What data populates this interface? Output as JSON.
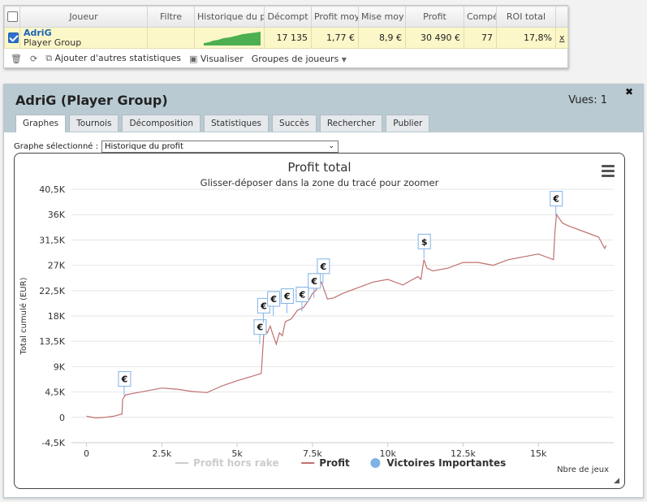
{
  "table": {
    "headers": [
      "Joueur",
      "Filtre",
      "Historique du p",
      "Décompt",
      "Profit moy",
      "Mise moy",
      "Profit",
      "Compé",
      "ROI total"
    ],
    "player_name": "AdriG",
    "player_group": "Player Group",
    "decompte": "17 135",
    "profit_moy": "1,77 €",
    "mise_moy": "8,9 €",
    "profit": "30 490 €",
    "compe": "77",
    "roi": "17,8%",
    "remove": "x"
  },
  "toolbar": {
    "add_stats": "Ajouter d'autres statistiques",
    "visualize": "Visualiser",
    "groups": "Groupes de joueurs"
  },
  "panel": {
    "title": "AdriG (Player Group)",
    "views": "Vues: 1",
    "close": "✖",
    "tabs": [
      "Graphes",
      "Tournois",
      "Décomposition",
      "Statistiques",
      "Succès",
      "Rechercher",
      "Publier"
    ],
    "select_label": "Graphe sélectionné :",
    "select_value": "Historique du profit"
  },
  "chart_data": {
    "type": "line",
    "title": "Profit total",
    "subtitle": "Glisser-déposer dans la zone du tracé pour zoomer",
    "ylabel": "Total cumulé (EUR)",
    "xlabel": "Nbre de jeux",
    "xlim": [
      -500,
      17500
    ],
    "ylim": [
      -4500,
      40500
    ],
    "xticks": [
      0,
      2500,
      5000,
      7500,
      10000,
      12500,
      15000
    ],
    "xtick_labels": [
      "0",
      "2.5k",
      "5k",
      "7.5k",
      "10k",
      "12.5k",
      "15k"
    ],
    "yticks": [
      -4500,
      0,
      4500,
      9000,
      13500,
      18000,
      22500,
      27000,
      31500,
      36000,
      40500
    ],
    "ytick_labels": [
      "-4,5K",
      "0",
      "4,5K",
      "9K",
      "13,5K",
      "18K",
      "22,5K",
      "27K",
      "31,5K",
      "36K",
      "40,5K"
    ],
    "legend": [
      {
        "name": "Profit hors rake",
        "color": "#cccccc",
        "marker": "line"
      },
      {
        "name": "Profit",
        "color": "#c07070",
        "marker": "line"
      },
      {
        "name": "Victoires Importantes",
        "color": "#7fb2e5",
        "marker": "circle"
      }
    ],
    "series": [
      {
        "name": "Profit",
        "color": "#c07070",
        "x": [
          0,
          300,
          600,
          900,
          1180,
          1200,
          1300,
          1500,
          2000,
          2500,
          3000,
          3500,
          4000,
          4500,
          5000,
          5500,
          5800,
          5850,
          5900,
          6000,
          6100,
          6200,
          6300,
          6400,
          6500,
          6600,
          6800,
          7000,
          7200,
          7400,
          7500,
          7600,
          7800,
          8000,
          8200,
          8500,
          9000,
          9500,
          10000,
          10500,
          11000,
          11100,
          11200,
          11300,
          11500,
          12000,
          12500,
          13000,
          13500,
          14000,
          14500,
          15000,
          15500,
          15550,
          15600,
          15800,
          16000,
          16500,
          17000,
          17200,
          17250
        ],
        "y": [
          200,
          -100,
          0,
          200,
          600,
          3200,
          4000,
          4200,
          4700,
          5200,
          5000,
          4600,
          4400,
          5600,
          6500,
          7300,
          7800,
          12000,
          16000,
          15000,
          16200,
          14500,
          13000,
          15000,
          14500,
          17000,
          17500,
          19000,
          19500,
          21000,
          22000,
          22500,
          24000,
          21000,
          21200,
          22000,
          23000,
          24000,
          24500,
          23500,
          25000,
          24500,
          28000,
          26500,
          26000,
          26500,
          27500,
          27500,
          27000,
          28000,
          28500,
          29000,
          28000,
          33000,
          36000,
          34500,
          34000,
          33000,
          32000,
          30000,
          30500
        ]
      }
    ],
    "victories": [
      {
        "x": 1250,
        "y": 3800,
        "label": "€"
      },
      {
        "x": 5750,
        "y": 13000,
        "label": "€"
      },
      {
        "x": 5870,
        "y": 16800,
        "label": "€"
      },
      {
        "x": 6200,
        "y": 18000,
        "label": "€"
      },
      {
        "x": 6650,
        "y": 18500,
        "label": "€"
      },
      {
        "x": 7150,
        "y": 18800,
        "label": "€"
      },
      {
        "x": 7550,
        "y": 21200,
        "label": "€"
      },
      {
        "x": 7850,
        "y": 23800,
        "label": "€"
      },
      {
        "x": 11200,
        "y": 28200,
        "label": "$"
      },
      {
        "x": 15580,
        "y": 35800,
        "label": "€"
      }
    ]
  }
}
